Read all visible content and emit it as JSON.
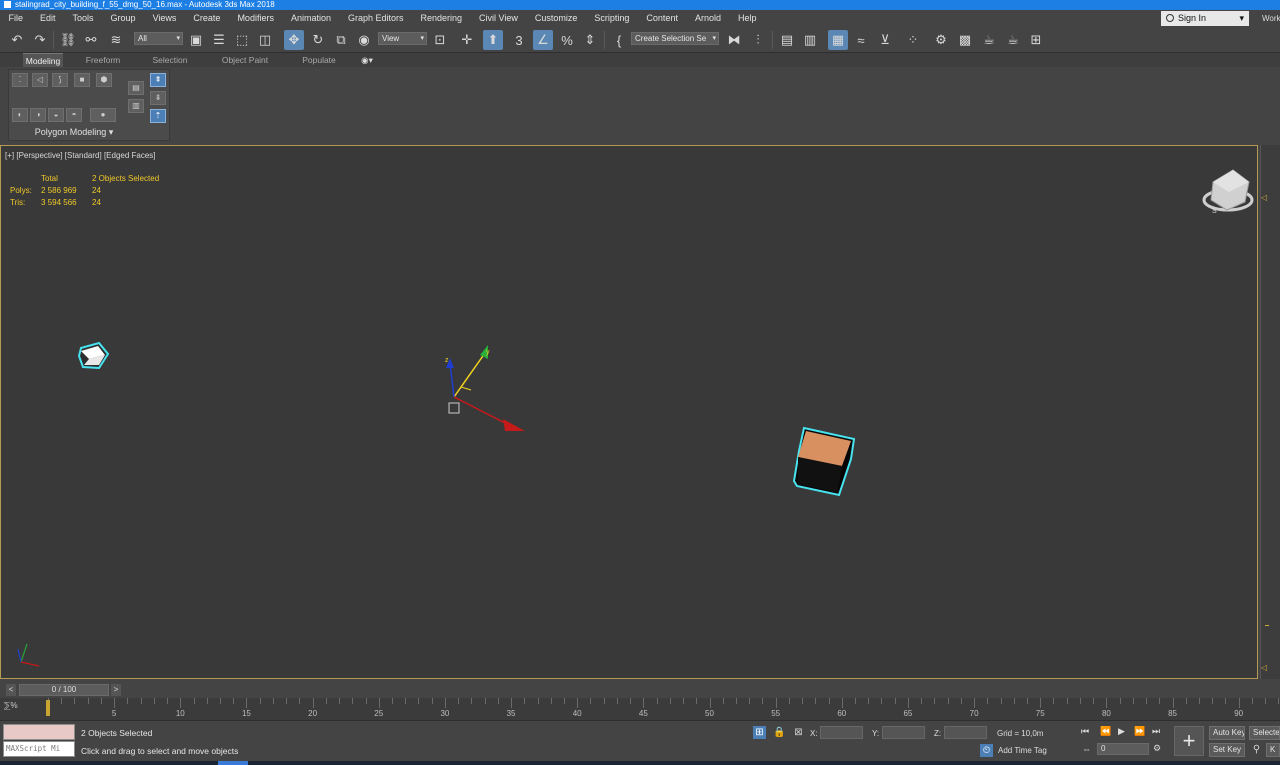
{
  "window": {
    "title": "stalingrad_city_building_f_55_dmg_50_16.max - Autodesk 3ds Max 2018"
  },
  "menu": {
    "items": [
      "File",
      "Edit",
      "Tools",
      "Group",
      "Views",
      "Create",
      "Modifiers",
      "Animation",
      "Graph Editors",
      "Rendering",
      "Civil View",
      "Customize",
      "Scripting",
      "Content",
      "Arnold",
      "Help"
    ],
    "sign_in": "Sign In",
    "workspace": "Work"
  },
  "toolbar": {
    "filter_value": "All",
    "view_value": "View",
    "selection_set_value": "Create Selection Se"
  },
  "ribbon": {
    "tabs": [
      "Modeling",
      "Freeform",
      "Selection",
      "Object Paint",
      "Populate"
    ],
    "active_tab": "Modeling",
    "panel_label": "Polygon Modeling"
  },
  "viewport": {
    "label": "[+] [Perspective] [Standard] [Edged Faces]",
    "stats": {
      "header_total": "Total",
      "header_selected": "2 Objects Selected",
      "polys_label": "Polys:",
      "polys_total": "2 586 969",
      "polys_selected": "24",
      "tris_label": "Tris:",
      "tris_total": "3 594 566",
      "tris_selected": "24"
    },
    "colors": {
      "selection_outline": "#47e3ef",
      "cube_top": "#d99060",
      "cube_side": "#111111",
      "small_cube_face": "#ffffff",
      "stats_text": "#f0c929",
      "border": "#b49a53"
    }
  },
  "timeline": {
    "frame_display": "0 / 100",
    "ticks": [
      "5",
      "10",
      "15",
      "20",
      "25",
      "30",
      "35",
      "40",
      "45",
      "50",
      "55",
      "60",
      "65",
      "70",
      "75",
      "80",
      "85",
      "90"
    ]
  },
  "status": {
    "selection_text": "2 Objects Selected",
    "prompt_text": "Click and drag to select and move objects",
    "maxscript_placeholder": "MAXScript Mi",
    "x_label": "X:",
    "y_label": "Y:",
    "z_label": "Z:",
    "grid_text": "Grid = 10,0m",
    "add_time_tag": "Add Time Tag",
    "current_frame": "0",
    "auto_key": "Auto Key",
    "set_key": "Set Key",
    "selected_label": "Selected",
    "key_filter_label": "K"
  }
}
